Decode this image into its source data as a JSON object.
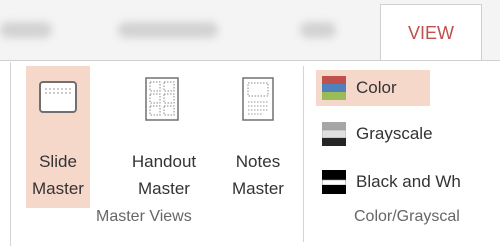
{
  "tabs": {
    "active_label": "VIEW"
  },
  "groups": {
    "master_views": {
      "label": "Master Views",
      "buttons": [
        {
          "line1": "Slide",
          "line2": "Master",
          "icon": "slide-master-icon"
        },
        {
          "line1": "Handout",
          "line2": "Master",
          "icon": "handout-master-icon"
        },
        {
          "line1": "Notes",
          "line2": "Master",
          "icon": "notes-master-icon"
        }
      ]
    },
    "color_grayscale": {
      "label": "Color/Grayscal",
      "buttons": [
        {
          "label": "Color",
          "icon": "color-icon"
        },
        {
          "label": "Grayscale",
          "icon": "grayscale-icon"
        },
        {
          "label": "Black and Wh",
          "icon": "black-and-white-icon"
        }
      ]
    }
  },
  "colors": {
    "accent": "#c0504d",
    "active_highlight": "#f6d8cb"
  }
}
